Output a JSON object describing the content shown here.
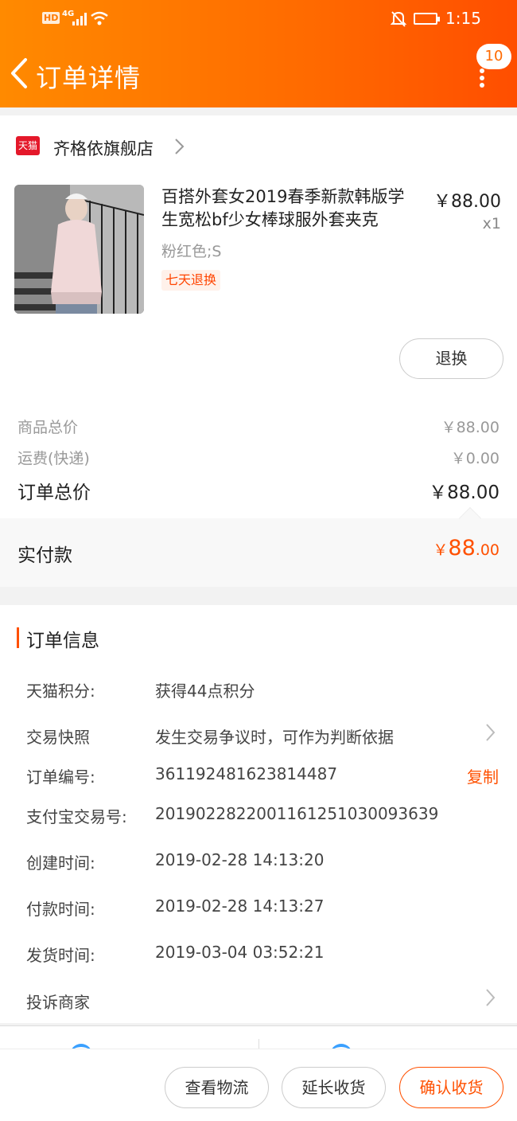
{
  "status_bar": {
    "hd": "HD",
    "network": "4G",
    "time": "1:15"
  },
  "header": {
    "title": "订单详情",
    "badge_count": "10"
  },
  "shop": {
    "platform_badge": "天猫",
    "name": "齐格依旗舰店"
  },
  "product": {
    "title": "百搭外套女2019春季新款韩版学生宽松bf少女棒球服外套夹克",
    "price": "￥88.00",
    "quantity": "x1",
    "sku": "粉红色;S",
    "tag": "七天退换",
    "action_label": "退换"
  },
  "summary": {
    "goods_total_label": "商品总价",
    "goods_total_value": "￥88.00",
    "shipping_label": "运费(快递)",
    "shipping_value": "￥0.00",
    "order_total_label": "订单总价",
    "order_total_value": "￥88.00",
    "paid_label": "实付款",
    "paid_currency": "￥",
    "paid_int": "88",
    "paid_dec": ".00"
  },
  "order_info": {
    "section_title": "订单信息",
    "rows": [
      {
        "label": "天猫积分:",
        "value": "获得44点积分"
      },
      {
        "label": "交易快照",
        "value": "发生交易争议时，可作为判断依据"
      },
      {
        "label": "订单编号:",
        "value": "361192481623814487",
        "action": "复制"
      },
      {
        "label": "支付宝交易号:",
        "value": "2019022822001161251030093639"
      },
      {
        "label": "创建时间:",
        "value": "2019-02-28 14:13:20"
      },
      {
        "label": "付款时间:",
        "value": "2019-02-28 14:13:27"
      },
      {
        "label": "发货时间:",
        "value": "2019-03-04 03:52:21"
      },
      {
        "label": "投诉商家",
        "value": ""
      }
    ]
  },
  "bottom_bar": {
    "view_logistics": "查看物流",
    "extend_receipt": "延长收货",
    "confirm_receipt": "确认收货"
  },
  "colors": {
    "accent": "#ff5000",
    "header_start": "#ff8a00",
    "header_end": "#ff4e00",
    "tmall_red": "#e4182a"
  },
  "icons": [
    "back-icon",
    "more-icon",
    "chevron-right-icon",
    "tmall-icon",
    "wifi-icon",
    "signal-icon",
    "bell-muted-icon",
    "battery-icon"
  ]
}
